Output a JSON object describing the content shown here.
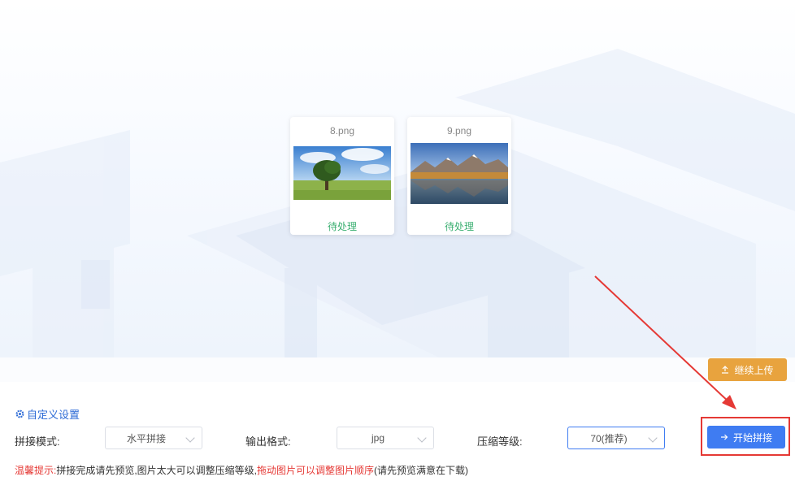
{
  "files": [
    {
      "name": "8.png",
      "status": "待处理",
      "thumb": "tree-landscape"
    },
    {
      "name": "9.png",
      "status": "待处理",
      "thumb": "mountain-lake"
    }
  ],
  "actions": {
    "continue_upload": "继续上传",
    "start_merge": "开始拼接"
  },
  "settings": {
    "title": "自定义设置",
    "mode_label": "拼接模式:",
    "mode_value": "水平拼接",
    "format_label": "输出格式:",
    "format_value": "jpg",
    "compression_label": "压缩等级:",
    "compression_value": "70(推荐)"
  },
  "tip": {
    "prefix": "温馨提示:",
    "text1": "拼接完成请先预览,图片太大可以调整压缩等级,",
    "highlight": "拖动图片可以调整图片顺序",
    "text2": "(请先预览满意在下载)"
  },
  "colors": {
    "primary": "#3f7cf2",
    "warning": "#e8a33e",
    "annotation_red": "#e53935",
    "status_green": "#3db073"
  },
  "icons": {
    "settings": "gear-icon",
    "upload": "upload-icon",
    "start": "arrow-right-icon"
  }
}
